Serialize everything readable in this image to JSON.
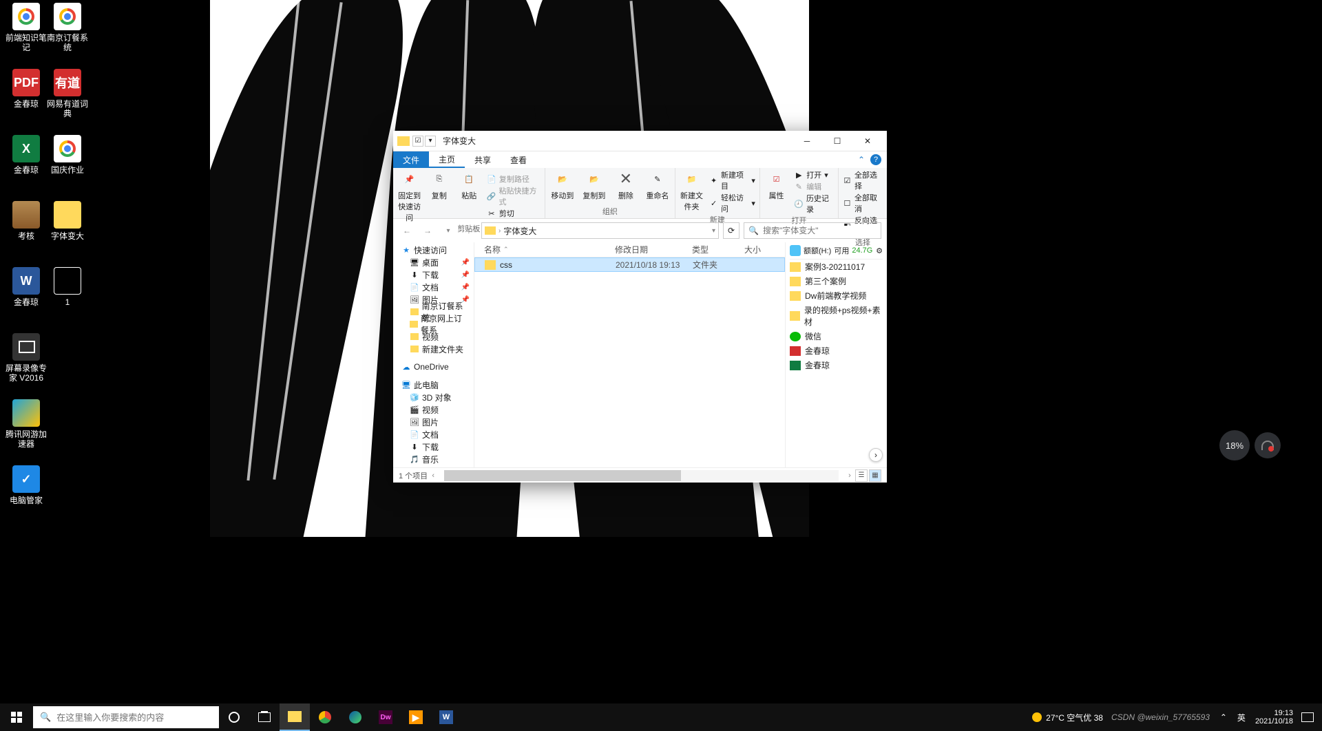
{
  "desktop_icons": [
    {
      "row": 0,
      "col": 0,
      "label": "前端知识笔记",
      "cls": "chrome"
    },
    {
      "row": 0,
      "col": 1,
      "label": "南京订餐系统",
      "cls": "chrome"
    },
    {
      "row": 1,
      "col": 0,
      "label": "金春琼",
      "cls": "pdf",
      "txt": "PDF"
    },
    {
      "row": 1,
      "col": 1,
      "label": "网易有道词典",
      "cls": "youdao",
      "txt": "有道"
    },
    {
      "row": 2,
      "col": 0,
      "label": "金春琼",
      "cls": "excel",
      "txt": "X"
    },
    {
      "row": 2,
      "col": 1,
      "label": "国庆作业",
      "cls": "chrome"
    },
    {
      "row": 3,
      "col": 0,
      "label": "考核",
      "cls": "winrar"
    },
    {
      "row": 3,
      "col": 1,
      "label": "字体变大",
      "cls": "folder"
    },
    {
      "row": 4,
      "col": 0,
      "label": "金春琼",
      "cls": "word",
      "txt": "W"
    },
    {
      "row": 4,
      "col": 1,
      "label": "1",
      "cls": "thumb"
    },
    {
      "row": 5,
      "col": 0,
      "label": "屏幕录像专家 V2016",
      "cls": "recorder"
    },
    {
      "row": 6,
      "col": 0,
      "label": "腾讯网游加速器",
      "cls": "accel"
    },
    {
      "row": 7,
      "col": 0,
      "label": "电脑管家",
      "cls": "tencent",
      "txt": "✓"
    }
  ],
  "explorer": {
    "title": "字体变大",
    "tabs": {
      "file": "文件",
      "home": "主页",
      "share": "共享",
      "view": "查看"
    },
    "ribbon": {
      "clipboard": {
        "label": "剪贴板",
        "pin": "固定到快速访问",
        "copy": "复制",
        "paste": "粘贴",
        "copy_path": "复制路径",
        "paste_shortcut": "粘贴快捷方式",
        "cut": "剪切"
      },
      "organize": {
        "label": "组织",
        "move": "移动到",
        "copyto": "复制到",
        "delete": "删除",
        "rename": "重命名"
      },
      "new": {
        "label": "新建",
        "folder": "新建文件夹",
        "new_item": "新建项目",
        "easy_access": "轻松访问"
      },
      "open": {
        "label": "打开",
        "props": "属性",
        "open_btn": "打开",
        "edit": "编辑",
        "history": "历史记录"
      },
      "select": {
        "label": "选择",
        "all": "全部选择",
        "none": "全部取消",
        "invert": "反向选择"
      }
    },
    "path_seg": "字体变大",
    "search_placeholder": "搜索\"字体变大\"",
    "sidebar": {
      "quick": "快速访问",
      "quick_items": [
        {
          "label": "桌面",
          "pin": true
        },
        {
          "label": "下载",
          "pin": true
        },
        {
          "label": "文档",
          "pin": true
        },
        {
          "label": "图片",
          "pin": true
        },
        {
          "label": "南京订餐系统"
        },
        {
          "label": "南京网上订餐系"
        },
        {
          "label": "视频"
        },
        {
          "label": "新建文件夹"
        }
      ],
      "onedrive": "OneDrive",
      "thispc": "此电脑",
      "pc_items": [
        "3D 对象",
        "视频",
        "图片",
        "文档",
        "下载",
        "音乐"
      ]
    },
    "columns": {
      "name": "名称",
      "date": "修改日期",
      "type": "类型",
      "size": "大小"
    },
    "rows": [
      {
        "name": "css",
        "date": "2021/10/18 19:13",
        "type": "文件夹"
      }
    ],
    "right": {
      "quota_label": "额额(H:)",
      "quota_avail_label": "可用",
      "quota_avail": "24.7G",
      "items": [
        {
          "label": "案例3-20211017",
          "cls": ""
        },
        {
          "label": "第三个案例",
          "cls": ""
        },
        {
          "label": "Dw前端教学视频",
          "cls": ""
        },
        {
          "label": "录的视频+ps视频+素材",
          "cls": ""
        },
        {
          "label": "微信",
          "cls": "wx"
        },
        {
          "label": "金春琼",
          "cls": "pdf"
        },
        {
          "label": "金春琼",
          "cls": "xls"
        }
      ]
    },
    "status": "1 个项目"
  },
  "float_indicator": "18%",
  "taskbar": {
    "search_placeholder": "在这里输入你要搜索的内容",
    "weather": "27°C 空气优 38",
    "watermark": "CSDN @weixin_57765593",
    "ime": "英",
    "time": "19:13",
    "date": "2021/10/18"
  }
}
